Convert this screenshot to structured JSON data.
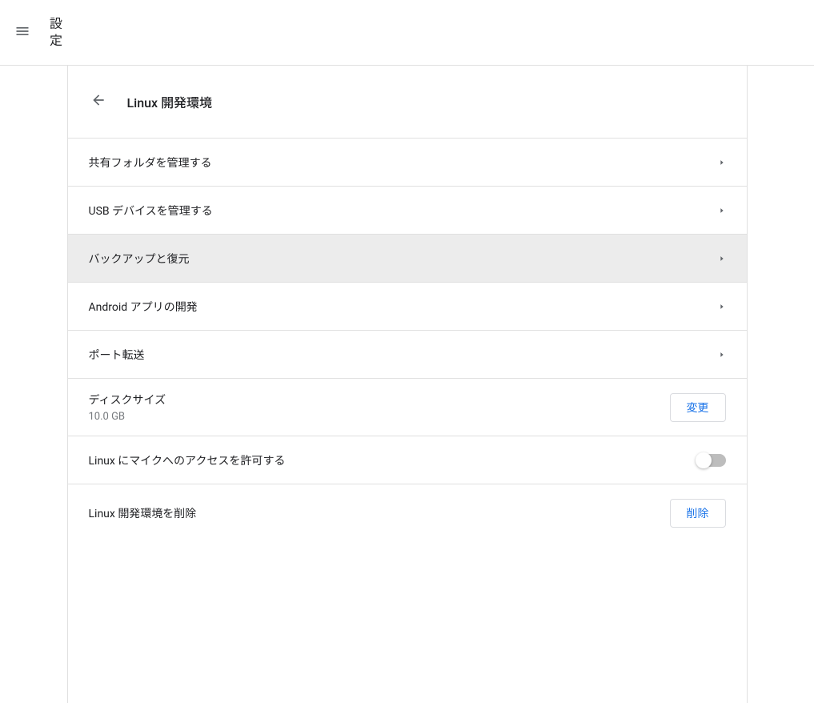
{
  "topBar": {
    "title": "設定"
  },
  "page": {
    "title": "Linux 開発環境"
  },
  "rows": {
    "sharedFolders": {
      "label": "共有フォルダを管理する"
    },
    "usb": {
      "label": "USB デバイスを管理する"
    },
    "backup": {
      "label": "バックアップと復元"
    },
    "android": {
      "label": "Android アプリの開発"
    },
    "port": {
      "label": "ポート転送"
    },
    "disk": {
      "label": "ディスクサイズ",
      "value": "10.0 GB",
      "button": "変更"
    },
    "mic": {
      "label": "Linux にマイクへのアクセスを許可する",
      "enabled": false
    },
    "remove": {
      "label": "Linux 開発環境を削除",
      "button": "削除"
    }
  }
}
